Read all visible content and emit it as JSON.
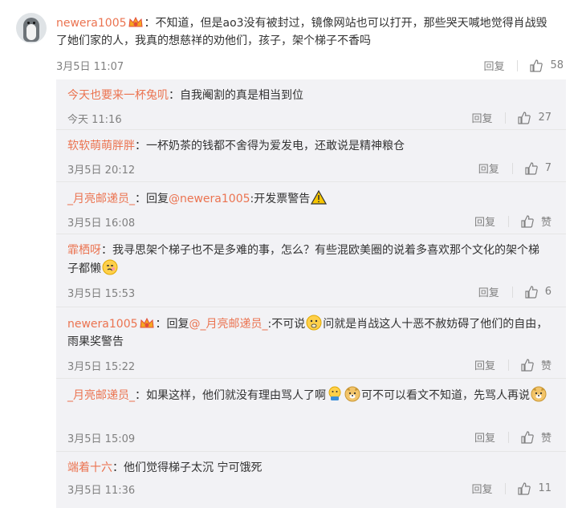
{
  "main_comment": {
    "username": "newera1005",
    "text": "：不知道，但是ao3没有被封过，镜像网站也可以打开，那些哭天喊地觉得肖战毁了她们家的人，我真的想慈祥的劝他们，孩子，架个梯子不香吗",
    "time": "3月5日 11:07",
    "reply_label": "回复",
    "likes": "58"
  },
  "replies": [
    {
      "username": "今天也要来一杯兔叽",
      "text": "：自我阉割的真是相当到位",
      "time": "今天 11:16",
      "reply_label": "回复",
      "likes": "27"
    },
    {
      "username": "软软萌萌胖胖",
      "text": "：一杯奶茶的钱都不舍得为爱发电，还敢说是精神粮仓",
      "time": "3月5日 20:12",
      "reply_label": "回复",
      "likes": "7"
    },
    {
      "username": "_月亮邮递员_",
      "text_pre": "：回复",
      "mention": "@newera1005",
      "text_post": ":开发票警告",
      "time": "3月5日 16:08",
      "reply_label": "回复",
      "likes": "赞"
    },
    {
      "username": "霏栖呀",
      "text": "：我寻思架个梯子也不是多难的事，怎么？有些混欧美圈的说着多喜欢那个文化的架个梯子都懒",
      "time": "3月5日 15:53",
      "reply_label": "回复",
      "likes": "6"
    },
    {
      "username": "newera1005",
      "text_pre": "：回复",
      "mention": "@_月亮邮递员_",
      "text_mid": ":不可说",
      "text_post": "问就是肖战这人十恶不赦妨碍了他们的自由，雨果奖警告",
      "time": "3月5日 15:22",
      "reply_label": "回复",
      "likes": "赞"
    },
    {
      "username": "_月亮邮递员_",
      "text_pre": "：如果这样，他们就没有理由骂人了啊",
      "text_post": "可不可以看文不知道，先骂人再说",
      "time": "3月5日 15:09",
      "reply_label": "回复",
      "likes": "赞"
    },
    {
      "username": "端着十六",
      "text": "：他们觉得梯子太沉 宁可饿死",
      "time": "3月5日 11:36",
      "reply_label": "回复",
      "likes": "11"
    }
  ],
  "colors": {
    "username": "#eb7350",
    "meta": "#808080",
    "reply_bg": "#f2f2f5"
  },
  "icons": [
    "penguin-avatar",
    "crown-badge-icon",
    "thumbs-up-icon",
    "thinking-emoji",
    "doge-emoji",
    "warning-icon",
    "awkward-emoji",
    "shy-emoji"
  ]
}
